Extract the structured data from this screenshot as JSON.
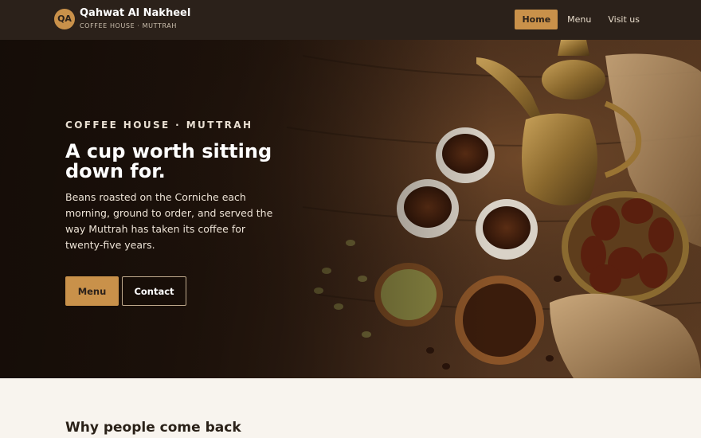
{
  "header": {
    "logo_initials": "QA",
    "brand_name": "Qahwat Al Nakheel",
    "brand_sub": "COFFEE HOUSE · MUTTRAH",
    "nav": [
      {
        "label": "Home",
        "active": true
      },
      {
        "label": "Menu",
        "active": false
      },
      {
        "label": "Visit us",
        "active": false
      }
    ]
  },
  "hero": {
    "eyebrow": "COFFEE HOUSE · MUTTRAH",
    "title": "A cup worth sitting down for.",
    "body": "Beans roasted on the Corniche each morning, ground to order, and served the way Muttrah has taken its coffee for twenty-five years.",
    "primary_button": "Menu",
    "secondary_button": "Contact"
  },
  "section": {
    "title": "Why people come back"
  },
  "colors": {
    "header_bg": "#2b211a",
    "accent": "#c9914a",
    "page_bg": "#f8f4ee"
  }
}
